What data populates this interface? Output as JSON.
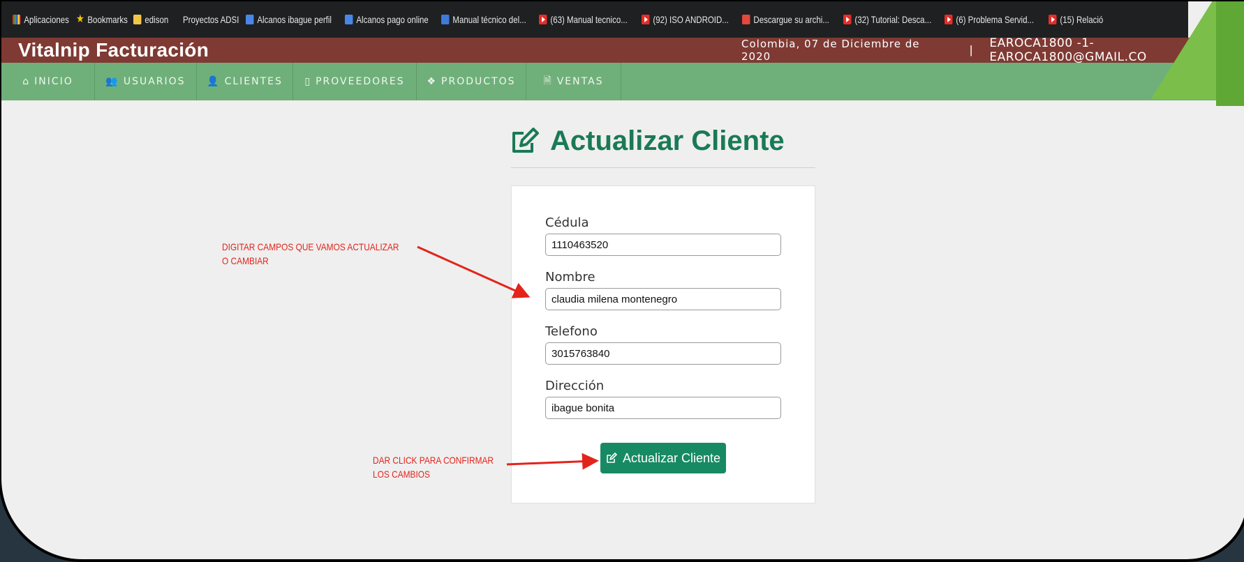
{
  "bookmarks": [
    {
      "label": "Aplicaciones",
      "icon": "apps-icon"
    },
    {
      "label": "Bookmarks",
      "icon": "star-icon"
    },
    {
      "label": "edison",
      "icon": "folder-icon"
    },
    {
      "label": "Proyectos ADSI",
      "icon": ""
    },
    {
      "label": "Alcanos ibague perfil",
      "icon": "site-icon"
    },
    {
      "label": "Alcanos pago online",
      "icon": "site-icon"
    },
    {
      "label": "Manual técnico del...",
      "icon": "doc-icon"
    },
    {
      "label": "(63) Manual tecnico...",
      "icon": "youtube-icon"
    },
    {
      "label": "(92) ISO ANDROID...",
      "icon": "youtube-icon"
    },
    {
      "label": "Descargue su archi...",
      "icon": "site-icon"
    },
    {
      "label": "(32) Tutorial: Desca...",
      "icon": "youtube-icon"
    },
    {
      "label": "(6) Problema Servid...",
      "icon": "youtube-icon"
    },
    {
      "label": "(15) Relació",
      "icon": "youtube-icon"
    }
  ],
  "header": {
    "brand": "Vitalnip Facturación",
    "date": "Colombia, 07 de Diciembre de 2020",
    "separator": "|",
    "user": "EAROCA1800 -1-EAROCA1800@GMAIL.CO"
  },
  "nav": [
    {
      "label": "INICIO",
      "icon": "home-icon",
      "glyph": "⌂"
    },
    {
      "label": "USUARIOS",
      "icon": "users-icon",
      "glyph": "👥"
    },
    {
      "label": "CLIENTES",
      "icon": "user-icon",
      "glyph": "👤"
    },
    {
      "label": "PROVEEDORES",
      "icon": "building-icon",
      "glyph": "▯"
    },
    {
      "label": "PRODUCTOS",
      "icon": "cubes-icon",
      "glyph": "❖"
    },
    {
      "label": "VENTAS",
      "icon": "file-icon",
      "glyph": "🗎"
    }
  ],
  "page": {
    "title": "Actualizar Cliente"
  },
  "form": {
    "cedula_label": "Cédula",
    "cedula_value": "1110463520",
    "nombre_label": "Nombre",
    "nombre_value": "claudia milena montenegro",
    "telefono_label": "Telefono",
    "telefono_value": "3015763840",
    "direccion_label": "Dirección",
    "direccion_value": "ibague bonita",
    "submit_label": "Actualizar Cliente"
  },
  "annotations": {
    "fields_line1": "DIGITAR CAMPOS QUE VAMOS ACTUALIZAR",
    "fields_line2": "O CAMBIAR",
    "button_line1": "DAR CLICK PARA CONFIRMAR",
    "button_line2": "LOS CAMBIOS"
  },
  "colors": {
    "header_bg": "#7f3a33",
    "nav_bg": "#6fb07a",
    "accent": "#178a64",
    "annotation": "#e3241b"
  }
}
